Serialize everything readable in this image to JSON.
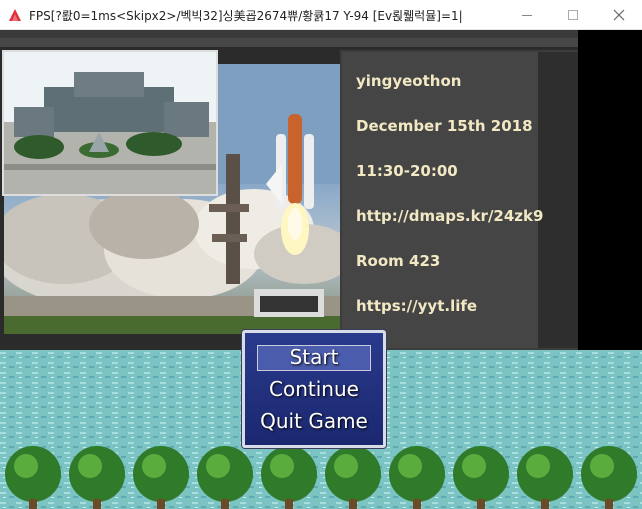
{
  "window": {
    "title": "FPS[?뢊0=1ms<Skipx2>/벡빅32]싱美굡2674쀼/황큙17 Y-94 [Ev뢵뤪럭뮬]=1|",
    "minimize_glyph": "—",
    "maximize_glyph": "□",
    "close_glyph": "✕"
  },
  "info_panel": {
    "lines": [
      "yingyeothon",
      "December 15th 2018",
      "11:30-20:00",
      "http://dmaps.kr/24zk9",
      "Room 423",
      "https://yyt.life"
    ]
  },
  "title_menu": {
    "items": [
      "Start",
      "Continue",
      "Quit Game"
    ],
    "selected_index": 0
  },
  "colors": {
    "menu_bg": "#1f2c78",
    "menu_border": "#d8dce8",
    "info_text": "#f2e8c4",
    "water": "#7fc7c7",
    "app_icon": "#e0303a"
  }
}
